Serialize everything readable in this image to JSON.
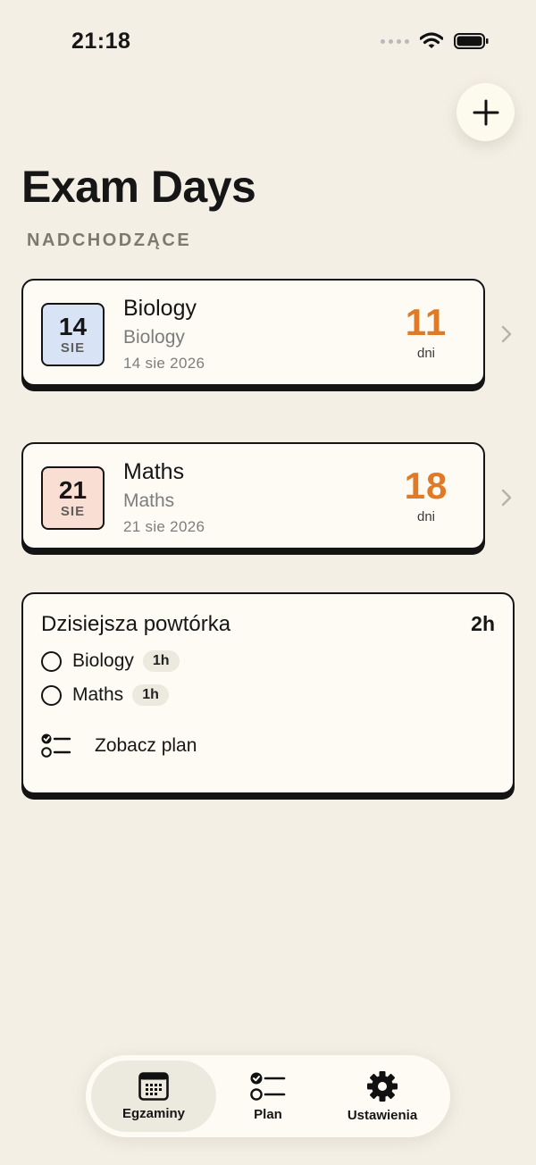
{
  "status_bar": {
    "time": "21:18"
  },
  "header": {
    "title": "Exam Days",
    "add_icon": "plus-icon"
  },
  "section": {
    "label": "NADCHODZĄCE"
  },
  "exams": [
    {
      "title": "Biology",
      "subject": "Biology",
      "date": "14 sie 2026",
      "day": "14",
      "month": "SIE",
      "count": "11",
      "unit": "dni",
      "tile_color": "#d8e3f6"
    },
    {
      "title": "Maths",
      "subject": "Maths",
      "date": "21 sie 2026",
      "day": "21",
      "month": "SIE",
      "count": "18",
      "unit": "dni",
      "tile_color": "#f9dfd3"
    }
  ],
  "review": {
    "title": "Dzisiejsza powtórka",
    "total": "2h",
    "tasks": [
      {
        "label": "Biology",
        "duration": "1h"
      },
      {
        "label": "Maths",
        "duration": "1h"
      }
    ],
    "plan_link": "Zobacz plan"
  },
  "tab_bar": {
    "tabs": [
      {
        "label": "Egzaminy",
        "icon": "calendar-icon",
        "active": true
      },
      {
        "label": "Plan",
        "icon": "checklist-icon",
        "active": false
      },
      {
        "label": "Ustawienia",
        "icon": "gear-icon",
        "active": false
      }
    ]
  },
  "colors": {
    "accent": "#e07a26",
    "background": "#f3efe5",
    "card": "#fdfbf3",
    "border": "#141414"
  }
}
